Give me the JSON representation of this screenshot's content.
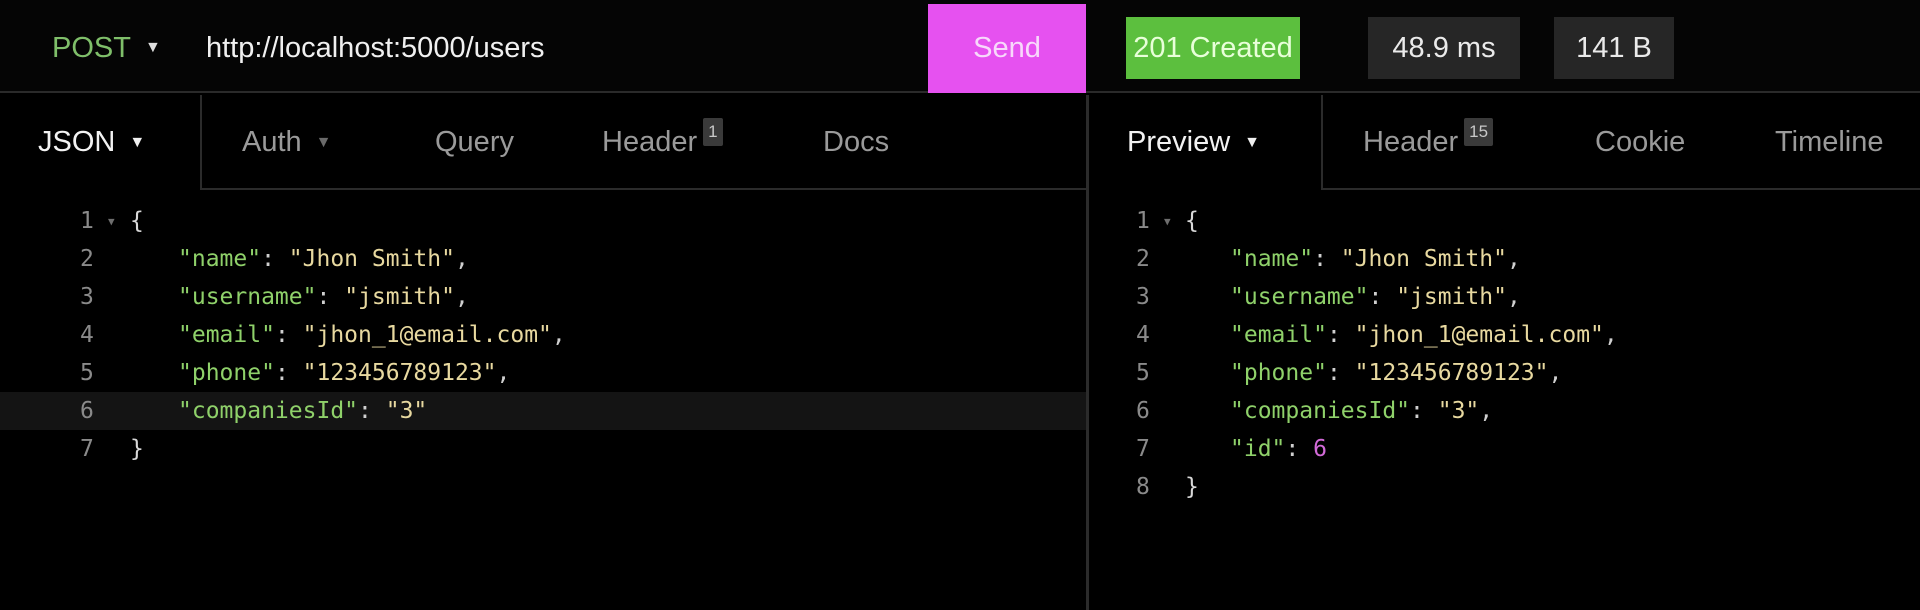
{
  "request": {
    "method": "POST",
    "url": "http://localhost:5000/users",
    "send_label": "Send"
  },
  "response_meta": {
    "status": "201 Created",
    "time": "48.9 ms",
    "size": "141 B",
    "colors": {
      "send": "#e651f0",
      "status_ok": "#5cbf3e"
    }
  },
  "request_tabs": {
    "body_type": "JSON",
    "auth": "Auth",
    "query": "Query",
    "header": "Header",
    "header_count": "1",
    "docs": "Docs"
  },
  "response_tabs": {
    "preview": "Preview",
    "header": "Header",
    "header_count": "15",
    "cookie": "Cookie",
    "timeline": "Timeline"
  },
  "request_body": {
    "lines": [
      {
        "n": "1",
        "open": "{"
      },
      {
        "n": "2",
        "key": "\"name\"",
        "value": "\"Jhon Smith\"",
        "comma": ","
      },
      {
        "n": "3",
        "key": "\"username\"",
        "value": "\"jsmith\"",
        "comma": ","
      },
      {
        "n": "4",
        "key": "\"email\"",
        "value": "\"jhon_1@email.com\"",
        "comma": ","
      },
      {
        "n": "5",
        "key": "\"phone\"",
        "value": "\"123456789123\"",
        "comma": ","
      },
      {
        "n": "6",
        "key": "\"companiesId\"",
        "value": "\"3\"",
        "comma": ""
      },
      {
        "n": "7",
        "close": "}"
      }
    ]
  },
  "response_body": {
    "lines": [
      {
        "n": "1",
        "open": "{"
      },
      {
        "n": "2",
        "key": "\"name\"",
        "value": "\"Jhon Smith\"",
        "comma": ","
      },
      {
        "n": "3",
        "key": "\"username\"",
        "value": "\"jsmith\"",
        "comma": ","
      },
      {
        "n": "4",
        "key": "\"email\"",
        "value": "\"jhon_1@email.com\"",
        "comma": ","
      },
      {
        "n": "5",
        "key": "\"phone\"",
        "value": "\"123456789123\"",
        "comma": ","
      },
      {
        "n": "6",
        "key": "\"companiesId\"",
        "value": "\"3\"",
        "comma": ","
      },
      {
        "n": "7",
        "key": "\"id\"",
        "value": "6",
        "comma": ""
      },
      {
        "n": "8",
        "close": "}"
      }
    ]
  }
}
